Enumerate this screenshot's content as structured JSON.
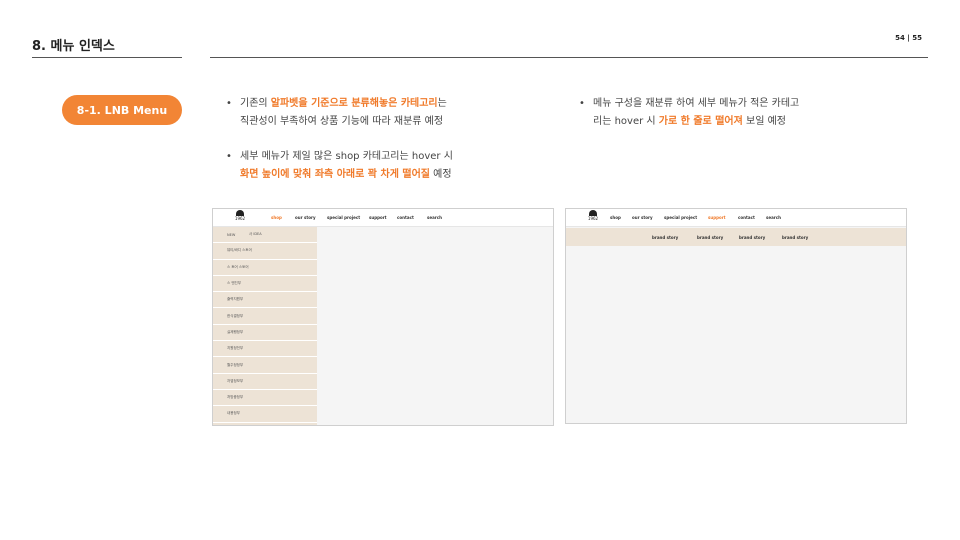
{
  "header": {
    "section_title": "8. 메뉴 인덱스",
    "page_number": "54  |  55"
  },
  "badge": {
    "label": "8-1. LNB Menu"
  },
  "bullets_left": [
    {
      "pre": "기존의 ",
      "hl": "알파벳을 기준으로 분류해놓은 카테고리",
      "post": "는",
      "line2": "직관성이 부족하여 상품 기능에 따라 재분류 예정"
    },
    {
      "line1": "세부 메뉴가 제일 많은 shop 카테고리는 hover 시",
      "hl": "화면 높이에 맞춰 좌측 아래로 꽉 차게 떨어질",
      "post": " 예정"
    }
  ],
  "bullet_right": {
    "line1": "메뉴 구성을 재분류 하여 세부 메뉴가 적은  카테고",
    "pre": "리는 hover 시 ",
    "hl": "가로 한 줄로 떨어져",
    "post": " 보일 예정"
  },
  "bullet_symbol": "•",
  "mockup_left": {
    "logo_text": "1962",
    "nav": [
      "shop",
      "our story",
      "special project",
      "support",
      "contact",
      "search"
    ],
    "active_nav": "shop",
    "lnb_first": [
      "NEW",
      "사 IDEA"
    ],
    "lnb_items": [
      "뷰티/바디 스토어",
      "스 토어 스토어",
      "스 엔진부",
      "출력지원부",
      "한식결정부",
      "실제행정부",
      "지원정전부",
      "월주정정부",
      "자엽정보부",
      "처방중정부",
      "내용정부"
    ]
  },
  "mockup_right": {
    "logo_text": "1962",
    "nav": [
      "shop",
      "our story",
      "special project",
      "support",
      "contact",
      "search"
    ],
    "active_nav": "support",
    "sub_items": [
      "brand story",
      "brand story",
      "brand story",
      "brand story"
    ]
  },
  "colors": {
    "accent": "#f28535",
    "highlight": "#f07a2a",
    "lnb_bg": "#ede3d6"
  }
}
